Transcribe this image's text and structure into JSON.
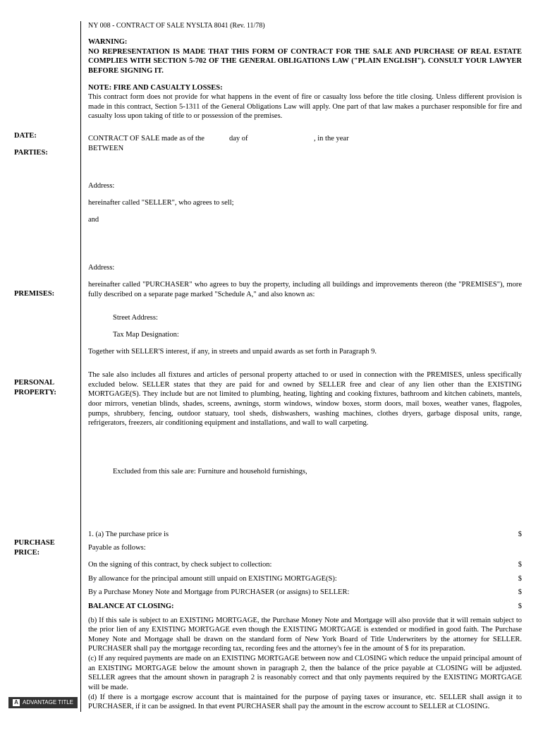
{
  "header": {
    "form_id": "NY 008 - CONTRACT OF SALE NYSLTA 8041 (Rev. 11/78)"
  },
  "warning": {
    "title": "WARNING:",
    "body": "NO REPRESENTATION IS MADE THAT THIS FORM OF CONTRACT FOR THE SALE AND PURCHASE OF REAL ESTATE COMPLIES WITH SECTION 5-702 OF THE GENERAL OBLIGATIONS LAW (\"PLAIN ENGLISH\"). CONSULT YOUR LAWYER BEFORE SIGNING IT."
  },
  "note": {
    "title": "NOTE: FIRE AND CASUALTY LOSSES:",
    "body": "This contract form does not provide for what happens in the event of fire or casualty loss before the title closing. Unless different provision is made in this contract, Section 5-1311 of the General Obligations Law will apply. One part of that law makes a purchaser responsible for fire and casualty loss upon taking of title to or possession of the premises."
  },
  "labels": {
    "date": "DATE:",
    "parties": "PARTIES:",
    "premises": "PREMISES:",
    "personal_property": "PERSONAL PROPERTY:",
    "purchase_price": "PURCHASE PRICE:"
  },
  "contract": {
    "line1_a": "CONTRACT OF SALE made as of the",
    "line1_b": "day of",
    "line1_c": ", in the year",
    "between": "BETWEEN",
    "address": "Address:",
    "seller_clause": "hereinafter called \"SELLER\", who agrees to sell;",
    "and": "and",
    "purchaser_clause": "hereinafter called \"PURCHASER\" who agrees to buy the property, including all buildings and improvements thereon (the \"PREMISES\"), more fully described on a separate page marked \"Schedule A,\" and also known as:",
    "street_address": "Street Address:",
    "tax_map": "Tax Map Designation:",
    "together": "Together with SELLER'S interest, if any, in streets and unpaid awards as set forth in Paragraph 9."
  },
  "personal_property": {
    "body": "The sale also includes all fixtures and articles of personal property attached to or used in connection with the PREMISES, unless specifically excluded below. SELLER states that they are paid for and owned by SELLER free and clear of any lien other than the EXISTING MORTGAGE(S). They include but are not limited to plumbing, heating, lighting and cooking fixtures, bathroom and kitchen cabinets, mantels, door mirrors, venetian blinds, shades, screens, awnings, storm windows, window boxes, storm doors, mail boxes, weather vanes, flagpoles, pumps, shrubbery, fencing, outdoor statuary, tool sheds, dishwashers, washing machines, clothes dryers, garbage disposal units, range, refrigerators, freezers, air conditioning equipment and installations, and wall to wall carpeting.",
    "excluded": "Excluded from this sale are: Furniture and household furnishings,"
  },
  "purchase": {
    "line_1a": "1. (a) The purchase price is",
    "payable": "Payable as follows:",
    "signing": "On the signing of this contract, by check subject to collection:",
    "allowance": "By allowance for the principal amount still unpaid on EXISTING MORTGAGE(S):",
    "money_note": "By a Purchase Money Note and Mortgage from PURCHASER (or assigns) to SELLER:",
    "balance_title": "BALANCE AT CLOSING:",
    "currency": "$",
    "clause_b": "(b) If this sale is subject to an EXISTING MORTGAGE, the Purchase Money Note and Mortgage will also provide that it will remain subject to the prior lien of any EXISTING MORTGAGE even though the EXISTING MORTGAGE is extended or modified in good faith. The Purchase Money Note and Mortgage shall be drawn on the standard form of New York Board of Title Underwriters by the attorney for SELLER. PURCHASER shall pay the mortgage recording tax, recording fees and the attorney's fee in the amount of $                    for its preparation.",
    "clause_c": "(c) If any required payments are made on an EXISTING MORTGAGE between now and CLOSING which reduce the unpaid principal amount of an EXISTING MORTGAGE below the amount shown in paragraph 2, then the balance of the price payable at CLOSING will be adjusted. SELLER agrees that the amount shown in paragraph 2 is reasonably correct and that only payments required by the EXISTING MORTGAGE will be made.",
    "clause_d": "(d) If there is a mortgage escrow account that is maintained for the purpose of paying taxes or insurance, etc. SELLER shall assign it to PURCHASER, if it can be assigned. In that event PURCHASER shall pay the amount in the escrow account to SELLER at CLOSING."
  },
  "badge": {
    "icon": "A",
    "text": "ADVANTAGE TITLE"
  }
}
